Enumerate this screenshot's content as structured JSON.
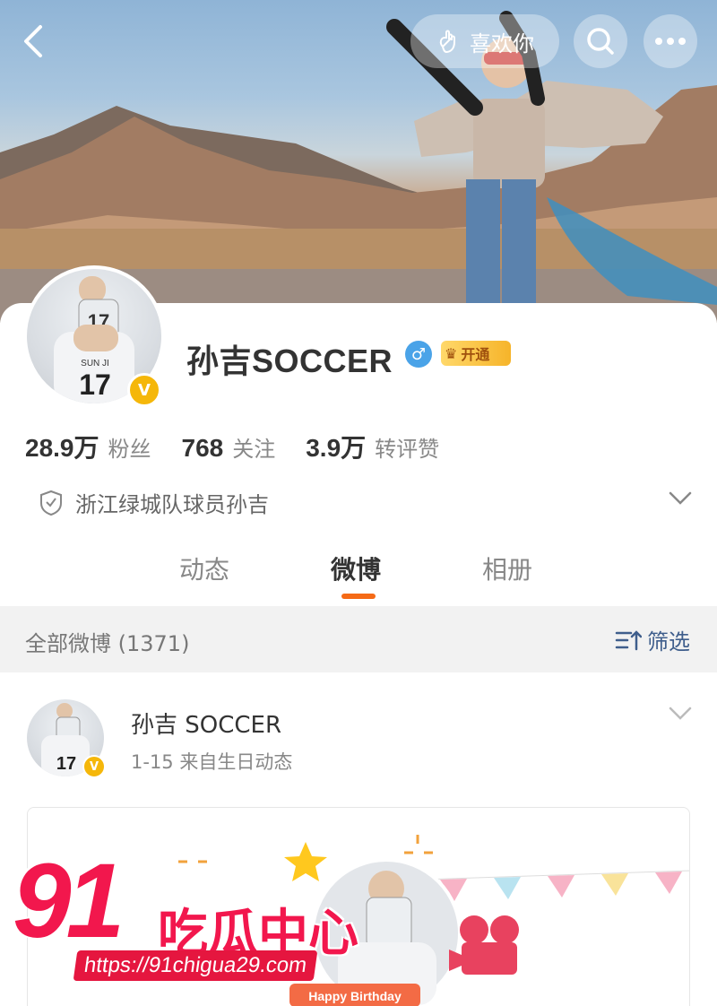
{
  "header": {
    "like_label": "喜欢你"
  },
  "profile": {
    "name": "孙吉SOCCER",
    "vip_label": "开通",
    "stats": [
      {
        "value": "28.9万",
        "label": "粉丝"
      },
      {
        "value": "768",
        "label": "关注"
      },
      {
        "value": "3.9万",
        "label": "转评赞"
      }
    ],
    "verification": "浙江绿城队球员孙吉"
  },
  "tabs": [
    {
      "label": "动态"
    },
    {
      "label": "微博"
    },
    {
      "label": "相册"
    }
  ],
  "filter": {
    "count_label": "全部微博 (1371)",
    "filter_label": "筛选"
  },
  "post": {
    "author": "孙吉 SOCCER",
    "meta": "1-15  来自生日动态",
    "image_text": "Happy Birthday"
  },
  "avatar_jersey": {
    "number": "17",
    "name": "SUN JI"
  },
  "watermark": {
    "number": "91",
    "title": "吃瓜中心",
    "url": "https://91chigua29.com"
  },
  "colors": {
    "accent": "#f56a16",
    "verified": "#f5b70a",
    "link": "#3f5e8c",
    "watermark": "#f2174d"
  }
}
